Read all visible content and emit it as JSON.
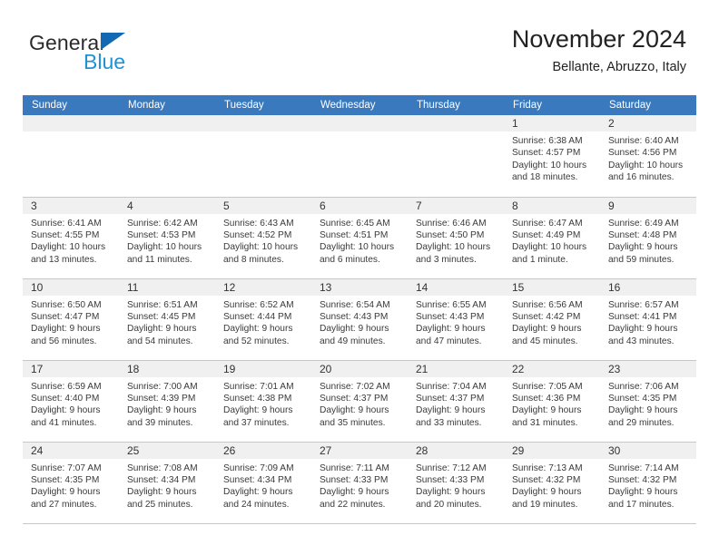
{
  "logo": {
    "text_top": "General",
    "text_bottom": "Blue",
    "triangle_color": "#1268b3",
    "blue_color": "#2191d6"
  },
  "header": {
    "title": "November 2024",
    "subtitle": "Bellante, Abruzzo, Italy"
  },
  "theme": {
    "header_row_bg": "#3b79bf",
    "header_row_text": "#ffffff",
    "daynum_band_bg": "#f0f0f0",
    "grid_line": "#c8c8c8"
  },
  "weekdays": [
    "Sunday",
    "Monday",
    "Tuesday",
    "Wednesday",
    "Thursday",
    "Friday",
    "Saturday"
  ],
  "weeks": [
    [
      {
        "day": "",
        "empty": true
      },
      {
        "day": "",
        "empty": true
      },
      {
        "day": "",
        "empty": true
      },
      {
        "day": "",
        "empty": true
      },
      {
        "day": "",
        "empty": true
      },
      {
        "day": "1",
        "sunrise": "Sunrise: 6:38 AM",
        "sunset": "Sunset: 4:57 PM",
        "daylight": "Daylight: 10 hours and 18 minutes."
      },
      {
        "day": "2",
        "sunrise": "Sunrise: 6:40 AM",
        "sunset": "Sunset: 4:56 PM",
        "daylight": "Daylight: 10 hours and 16 minutes."
      }
    ],
    [
      {
        "day": "3",
        "sunrise": "Sunrise: 6:41 AM",
        "sunset": "Sunset: 4:55 PM",
        "daylight": "Daylight: 10 hours and 13 minutes."
      },
      {
        "day": "4",
        "sunrise": "Sunrise: 6:42 AM",
        "sunset": "Sunset: 4:53 PM",
        "daylight": "Daylight: 10 hours and 11 minutes."
      },
      {
        "day": "5",
        "sunrise": "Sunrise: 6:43 AM",
        "sunset": "Sunset: 4:52 PM",
        "daylight": "Daylight: 10 hours and 8 minutes."
      },
      {
        "day": "6",
        "sunrise": "Sunrise: 6:45 AM",
        "sunset": "Sunset: 4:51 PM",
        "daylight": "Daylight: 10 hours and 6 minutes."
      },
      {
        "day": "7",
        "sunrise": "Sunrise: 6:46 AM",
        "sunset": "Sunset: 4:50 PM",
        "daylight": "Daylight: 10 hours and 3 minutes."
      },
      {
        "day": "8",
        "sunrise": "Sunrise: 6:47 AM",
        "sunset": "Sunset: 4:49 PM",
        "daylight": "Daylight: 10 hours and 1 minute."
      },
      {
        "day": "9",
        "sunrise": "Sunrise: 6:49 AM",
        "sunset": "Sunset: 4:48 PM",
        "daylight": "Daylight: 9 hours and 59 minutes."
      }
    ],
    [
      {
        "day": "10",
        "sunrise": "Sunrise: 6:50 AM",
        "sunset": "Sunset: 4:47 PM",
        "daylight": "Daylight: 9 hours and 56 minutes."
      },
      {
        "day": "11",
        "sunrise": "Sunrise: 6:51 AM",
        "sunset": "Sunset: 4:45 PM",
        "daylight": "Daylight: 9 hours and 54 minutes."
      },
      {
        "day": "12",
        "sunrise": "Sunrise: 6:52 AM",
        "sunset": "Sunset: 4:44 PM",
        "daylight": "Daylight: 9 hours and 52 minutes."
      },
      {
        "day": "13",
        "sunrise": "Sunrise: 6:54 AM",
        "sunset": "Sunset: 4:43 PM",
        "daylight": "Daylight: 9 hours and 49 minutes."
      },
      {
        "day": "14",
        "sunrise": "Sunrise: 6:55 AM",
        "sunset": "Sunset: 4:43 PM",
        "daylight": "Daylight: 9 hours and 47 minutes."
      },
      {
        "day": "15",
        "sunrise": "Sunrise: 6:56 AM",
        "sunset": "Sunset: 4:42 PM",
        "daylight": "Daylight: 9 hours and 45 minutes."
      },
      {
        "day": "16",
        "sunrise": "Sunrise: 6:57 AM",
        "sunset": "Sunset: 4:41 PM",
        "daylight": "Daylight: 9 hours and 43 minutes."
      }
    ],
    [
      {
        "day": "17",
        "sunrise": "Sunrise: 6:59 AM",
        "sunset": "Sunset: 4:40 PM",
        "daylight": "Daylight: 9 hours and 41 minutes."
      },
      {
        "day": "18",
        "sunrise": "Sunrise: 7:00 AM",
        "sunset": "Sunset: 4:39 PM",
        "daylight": "Daylight: 9 hours and 39 minutes."
      },
      {
        "day": "19",
        "sunrise": "Sunrise: 7:01 AM",
        "sunset": "Sunset: 4:38 PM",
        "daylight": "Daylight: 9 hours and 37 minutes."
      },
      {
        "day": "20",
        "sunrise": "Sunrise: 7:02 AM",
        "sunset": "Sunset: 4:37 PM",
        "daylight": "Daylight: 9 hours and 35 minutes."
      },
      {
        "day": "21",
        "sunrise": "Sunrise: 7:04 AM",
        "sunset": "Sunset: 4:37 PM",
        "daylight": "Daylight: 9 hours and 33 minutes."
      },
      {
        "day": "22",
        "sunrise": "Sunrise: 7:05 AM",
        "sunset": "Sunset: 4:36 PM",
        "daylight": "Daylight: 9 hours and 31 minutes."
      },
      {
        "day": "23",
        "sunrise": "Sunrise: 7:06 AM",
        "sunset": "Sunset: 4:35 PM",
        "daylight": "Daylight: 9 hours and 29 minutes."
      }
    ],
    [
      {
        "day": "24",
        "sunrise": "Sunrise: 7:07 AM",
        "sunset": "Sunset: 4:35 PM",
        "daylight": "Daylight: 9 hours and 27 minutes."
      },
      {
        "day": "25",
        "sunrise": "Sunrise: 7:08 AM",
        "sunset": "Sunset: 4:34 PM",
        "daylight": "Daylight: 9 hours and 25 minutes."
      },
      {
        "day": "26",
        "sunrise": "Sunrise: 7:09 AM",
        "sunset": "Sunset: 4:34 PM",
        "daylight": "Daylight: 9 hours and 24 minutes."
      },
      {
        "day": "27",
        "sunrise": "Sunrise: 7:11 AM",
        "sunset": "Sunset: 4:33 PM",
        "daylight": "Daylight: 9 hours and 22 minutes."
      },
      {
        "day": "28",
        "sunrise": "Sunrise: 7:12 AM",
        "sunset": "Sunset: 4:33 PM",
        "daylight": "Daylight: 9 hours and 20 minutes."
      },
      {
        "day": "29",
        "sunrise": "Sunrise: 7:13 AM",
        "sunset": "Sunset: 4:32 PM",
        "daylight": "Daylight: 9 hours and 19 minutes."
      },
      {
        "day": "30",
        "sunrise": "Sunrise: 7:14 AM",
        "sunset": "Sunset: 4:32 PM",
        "daylight": "Daylight: 9 hours and 17 minutes."
      }
    ]
  ]
}
